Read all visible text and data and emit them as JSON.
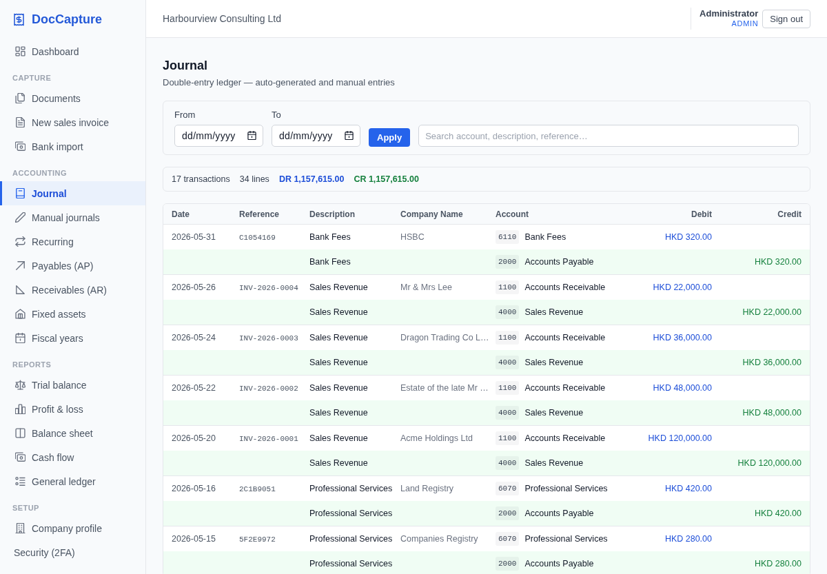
{
  "sidebar": {
    "brand": "DocCapture",
    "sections": [
      {
        "items": [
          {
            "label": "Dashboard",
            "kind": "icon",
            "selected": false
          }
        ]
      },
      {
        "title": "CAPTURE",
        "items": [
          {
            "label": "Documents",
            "kind": "icon",
            "selected": false
          },
          {
            "label": "New sales invoice",
            "kind": "icon",
            "selected": false
          },
          {
            "label": "Bank import",
            "kind": "icon",
            "selected": false
          }
        ]
      },
      {
        "title": "ACCOUNTING",
        "items": [
          {
            "label": "Journal",
            "kind": "icon",
            "selected": true
          },
          {
            "label": "Manual journals",
            "kind": "icon",
            "selected": false
          },
          {
            "label": "Recurring",
            "kind": "icon",
            "selected": false
          },
          {
            "label": "Payables (AP)",
            "kind": "icon",
            "selected": false
          },
          {
            "label": "Receivables (AR)",
            "kind": "icon",
            "selected": false
          },
          {
            "label": "Fixed assets",
            "kind": "icon",
            "selected": false
          },
          {
            "label": "Fiscal years",
            "kind": "icon",
            "selected": false
          }
        ]
      },
      {
        "title": "REPORTS",
        "items": [
          {
            "label": "Trial balance",
            "kind": "icon",
            "selected": false
          },
          {
            "label": "Profit & loss",
            "kind": "icon",
            "selected": false
          },
          {
            "label": "Balance sheet",
            "kind": "icon",
            "selected": false
          },
          {
            "label": "Cash flow",
            "kind": "icon",
            "selected": false
          },
          {
            "label": "General ledger",
            "kind": "icon",
            "selected": false
          }
        ]
      },
      {
        "title": "SETUP",
        "items": [
          {
            "label": "Company profile",
            "kind": "icon",
            "selected": false
          },
          {
            "label": "Security (2FA)",
            "kind": "text",
            "selected": false
          }
        ]
      }
    ]
  },
  "header": {
    "organization": "Harbourview Consulting Ltd",
    "user": {
      "name": "Administrator",
      "role": "ADMIN"
    },
    "sign_out": "Sign out"
  },
  "page": {
    "title": "Journal",
    "subtitle": "Double-entry ledger — auto-generated and manual entries"
  },
  "filters": {
    "from": {
      "label": "From",
      "placeholder": "dd/mm/yyyy"
    },
    "to": {
      "label": "To",
      "placeholder": "dd/mm/yyyy"
    },
    "apply": "Apply",
    "search": {
      "placeholder": "Search account, description, reference…"
    }
  },
  "summary": {
    "transactions": "17 transactions",
    "lines": "34 lines",
    "debit_total": "DR 1,157,615.00",
    "credit_total": "CR 1,157,615.00"
  },
  "table": {
    "columns": [
      "Date",
      "Reference",
      "Description",
      "Company Name",
      "Account",
      "Debit",
      "Credit"
    ],
    "transactions": [
      {
        "date": "2026-05-31",
        "reference": "C1054169",
        "company": "HSBC",
        "lines": [
          {
            "kind": "debit",
            "description": "Bank Fees",
            "account_code": "6110",
            "account_name": "Bank Fees",
            "amount": "HKD 320.00"
          },
          {
            "kind": "credit",
            "description": "Bank Fees",
            "account_code": "2000",
            "account_name": "Accounts Payable",
            "amount": "HKD 320.00"
          }
        ]
      },
      {
        "date": "2026-05-26",
        "reference": "INV-2026-0004",
        "company": "Mr & Mrs Lee",
        "lines": [
          {
            "kind": "debit",
            "description": "Sales Revenue",
            "account_code": "1100",
            "account_name": "Accounts Receivable",
            "amount": "HKD 22,000.00"
          },
          {
            "kind": "credit",
            "description": "Sales Revenue",
            "account_code": "4000",
            "account_name": "Sales Revenue",
            "amount": "HKD 22,000.00"
          }
        ]
      },
      {
        "date": "2026-05-24",
        "reference": "INV-2026-0003",
        "company": "Dragon Trading Co L…",
        "lines": [
          {
            "kind": "debit",
            "description": "Sales Revenue",
            "account_code": "1100",
            "account_name": "Accounts Receivable",
            "amount": "HKD 36,000.00"
          },
          {
            "kind": "credit",
            "description": "Sales Revenue",
            "account_code": "4000",
            "account_name": "Sales Revenue",
            "amount": "HKD 36,000.00"
          }
        ]
      },
      {
        "date": "2026-05-22",
        "reference": "INV-2026-0002",
        "company": "Estate of the late Mr …",
        "lines": [
          {
            "kind": "debit",
            "description": "Sales Revenue",
            "account_code": "1100",
            "account_name": "Accounts Receivable",
            "amount": "HKD 48,000.00"
          },
          {
            "kind": "credit",
            "description": "Sales Revenue",
            "account_code": "4000",
            "account_name": "Sales Revenue",
            "amount": "HKD 48,000.00"
          }
        ]
      },
      {
        "date": "2026-05-20",
        "reference": "INV-2026-0001",
        "company": "Acme Holdings Ltd",
        "lines": [
          {
            "kind": "debit",
            "description": "Sales Revenue",
            "account_code": "1100",
            "account_name": "Accounts Receivable",
            "amount": "HKD 120,000.00"
          },
          {
            "kind": "credit",
            "description": "Sales Revenue",
            "account_code": "4000",
            "account_name": "Sales Revenue",
            "amount": "HKD 120,000.00"
          }
        ]
      },
      {
        "date": "2026-05-16",
        "reference": "2C1B9051",
        "company": "Land Registry",
        "lines": [
          {
            "kind": "debit",
            "description": "Professional Services",
            "account_code": "6070",
            "account_name": "Professional Services",
            "amount": "HKD 420.00"
          },
          {
            "kind": "credit",
            "description": "Professional Services",
            "account_code": "2000",
            "account_name": "Accounts Payable",
            "amount": "HKD 420.00"
          }
        ]
      },
      {
        "date": "2026-05-15",
        "reference": "5F2E9972",
        "company": "Companies Registry",
        "lines": [
          {
            "kind": "debit",
            "description": "Professional Services",
            "account_code": "6070",
            "account_name": "Professional Services",
            "amount": "HKD 280.00"
          },
          {
            "kind": "credit",
            "description": "Professional Services",
            "account_code": "2000",
            "account_name": "Accounts Payable",
            "amount": "HKD 280.00"
          }
        ]
      }
    ]
  }
}
